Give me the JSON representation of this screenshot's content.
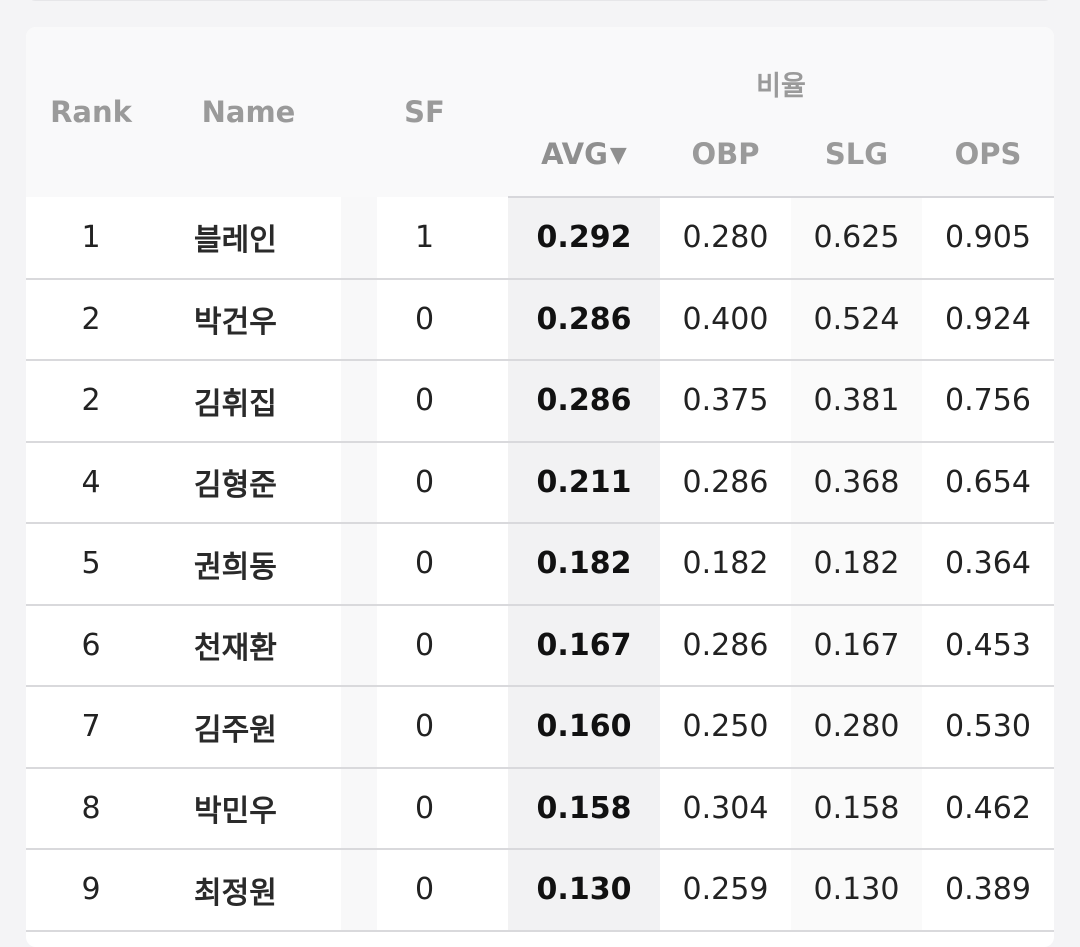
{
  "table": {
    "headers": {
      "rank": "Rank",
      "name": "Name",
      "sf": "SF",
      "group": "비율",
      "avg": "AVG",
      "avg_sort_indicator": "▼",
      "obp": "OBP",
      "slg": "SLG",
      "ops": "OPS"
    },
    "sorted_column": "AVG",
    "sort_direction": "descending",
    "rows": [
      {
        "rank": "1",
        "name": "블레인",
        "sf": "1",
        "avg": "0.292",
        "obp": "0.280",
        "slg": "0.625",
        "ops": "0.905"
      },
      {
        "rank": "2",
        "name": "박건우",
        "sf": "0",
        "avg": "0.286",
        "obp": "0.400",
        "slg": "0.524",
        "ops": "0.924"
      },
      {
        "rank": "2",
        "name": "김휘집",
        "sf": "0",
        "avg": "0.286",
        "obp": "0.375",
        "slg": "0.381",
        "ops": "0.756"
      },
      {
        "rank": "4",
        "name": "김형준",
        "sf": "0",
        "avg": "0.211",
        "obp": "0.286",
        "slg": "0.368",
        "ops": "0.654"
      },
      {
        "rank": "5",
        "name": "권희동",
        "sf": "0",
        "avg": "0.182",
        "obp": "0.182",
        "slg": "0.182",
        "ops": "0.364"
      },
      {
        "rank": "6",
        "name": "천재환",
        "sf": "0",
        "avg": "0.167",
        "obp": "0.286",
        "slg": "0.167",
        "ops": "0.453"
      },
      {
        "rank": "7",
        "name": "김주원",
        "sf": "0",
        "avg": "0.160",
        "obp": "0.250",
        "slg": "0.280",
        "ops": "0.530"
      },
      {
        "rank": "8",
        "name": "박민우",
        "sf": "0",
        "avg": "0.158",
        "obp": "0.304",
        "slg": "0.158",
        "ops": "0.462"
      },
      {
        "rank": "9",
        "name": "최정원",
        "sf": "0",
        "avg": "0.130",
        "obp": "0.259",
        "slg": "0.130",
        "ops": "0.389"
      }
    ]
  }
}
